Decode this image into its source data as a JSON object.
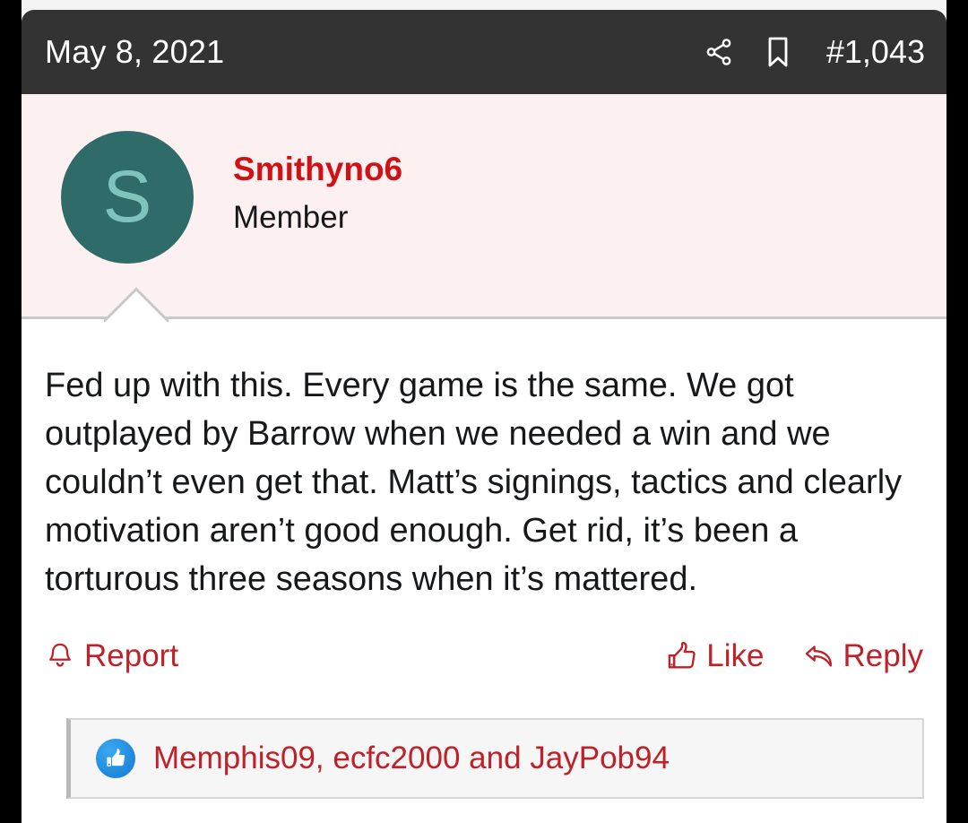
{
  "frame": {
    "background_color": "#000000"
  },
  "post": {
    "header": {
      "date": "May 8, 2021",
      "post_number": "#1,043",
      "background_color": "#333333",
      "icons": {
        "share": "share-icon",
        "bookmark": "bookmark-icon"
      }
    },
    "author": {
      "avatar_initial": "S",
      "avatar_background_color": "#2e6b69",
      "avatar_text_color": "#7fc4bc",
      "name": "Smithyno6",
      "name_color": "#d01217",
      "title": "Member",
      "strip_background_color": "#fdf0f1"
    },
    "message": {
      "text": "Fed up with this. Every game is the same. We got outplayed by Barrow when we needed a win and we couldn’t even get that. Matt’s signings, tactics and clearly motivation aren’t good enough. Get rid, it’s been a torturous three seasons when it’s mattered.",
      "text_color": "#16181a"
    },
    "actions": {
      "accent_color": "#c02128",
      "report": {
        "label": "Report",
        "icon": "bell-icon"
      },
      "like": {
        "label": "Like",
        "icon": "thumbs-up-icon"
      },
      "reply": {
        "label": "Reply",
        "icon": "reply-arrow-icon"
      }
    },
    "likes": {
      "badge_icon": "thumbs-up-badge-icon",
      "badge_color": "#1278d4",
      "names": "Memphis09, ecfc2000 and JayPob94",
      "names_color": "#c02128"
    }
  }
}
